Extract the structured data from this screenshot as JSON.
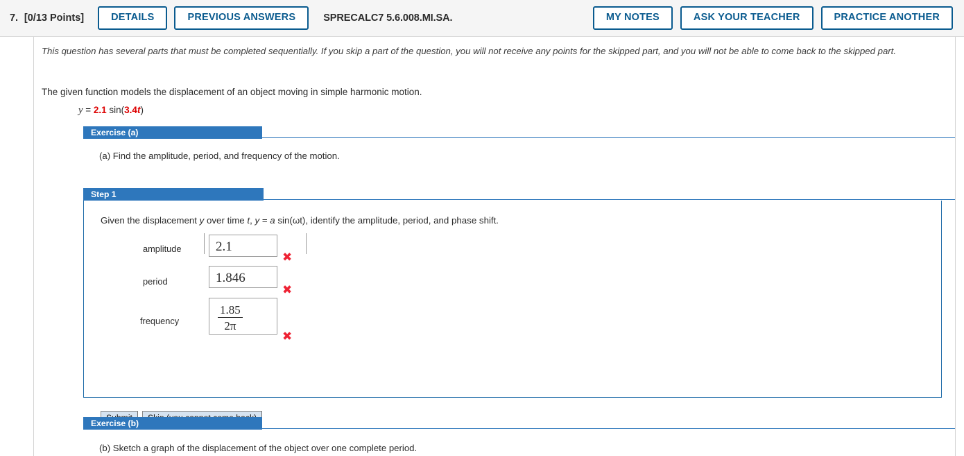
{
  "header": {
    "question_number": "7.",
    "points": "[0/13 Points]",
    "details_label": "DETAILS",
    "previous_answers_label": "PREVIOUS ANSWERS",
    "question_code": "SPRECALC7 5.6.008.MI.SA.",
    "my_notes_label": "MY NOTES",
    "ask_teacher_label": "ASK YOUR TEACHER",
    "practice_another_label": "PRACTICE ANOTHER",
    "accent_color": "#0a5b8f",
    "bar_background": "#f5f5f5"
  },
  "body": {
    "sequential_notice": "This question has several parts that must be completed sequentially. If you skip a part of the question, you will not receive any points for the skipped part, and you will not be able to come back to the skipped part.",
    "problem_statement": "The given function models the displacement of an object moving in simple harmonic motion.",
    "equation": {
      "lhs": "y",
      "equals": "=",
      "amplitude": "2.1",
      "sin": "sin(",
      "omega": "3.4",
      "t": "t",
      "close": ")",
      "highlight_color": "#dd0000"
    }
  },
  "exercise_a": {
    "tab_label": "Exercise (a)",
    "prompt": "(a) Find the amplitude, period, and frequency of the motion.",
    "tab_color": "#2e77bc"
  },
  "step1": {
    "tab_label": "Step 1",
    "instruction_pre": "Given the displacement ",
    "instruction_y": "y",
    "instruction_mid": " over time ",
    "instruction_t": "t",
    "instruction_comma": ",  ",
    "instruction_yeq": "y",
    "instruction_eq": " = ",
    "instruction_a": "a",
    "instruction_sin": " sin(ωt),  ",
    "instruction_tail": "identify the amplitude, period, and phase shift.",
    "fields": [
      {
        "label": "amplitude",
        "value": "2.1",
        "status": "incorrect",
        "status_mark": "✖"
      },
      {
        "label": "period",
        "value": "1.846",
        "status": "incorrect",
        "status_mark": "✖"
      },
      {
        "label": "frequency",
        "numerator": "1.85",
        "denominator": "2π",
        "status": "incorrect",
        "status_mark": "✖"
      }
    ],
    "submit_label": "Submit",
    "skip_label": "Skip (you cannot come back)",
    "incorrect_color": "#ee2233"
  },
  "exercise_b": {
    "tab_label": "Exercise (b)",
    "prompt": "(b) Sketch a graph of the displacement of the object over one complete period."
  }
}
